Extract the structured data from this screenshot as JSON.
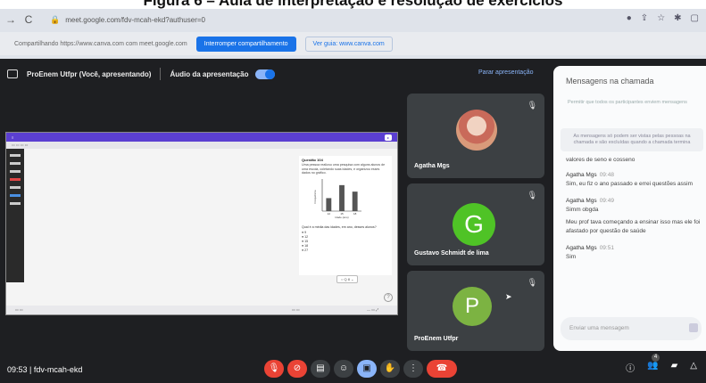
{
  "figure": {
    "caption": "Figura 6 – Aula de interpretação e resolução de exercícios"
  },
  "browser": {
    "back_glyph": "→",
    "reload_glyph": "C",
    "url": "meet.google.com/fdv-mcah-ekd?authuser=0",
    "share_text": "Compartilhando https://www.canva.com com meet.google.com",
    "stop_share_label": "Interromper compartilhamento",
    "guide_label": "Ver guia: www.canva.com"
  },
  "presentation_bar": {
    "title": "ProEnem Utfpr (Você, apresentando)",
    "audio_label": "Áudio da apresentação",
    "stop_label": "Parar apresentação"
  },
  "shared_screen": {
    "question_title": "Questão 104",
    "question_text": "Uma pessoa realizou uma pesquisa com alguns alunos de uma escola, coletando suas idades, e organizou esses dados no gráfico.",
    "question_prompt": "Qual é a média das idades, em ano, desses alunos?",
    "options": [
      "9",
      "12",
      "15",
      "18",
      "27"
    ],
    "zoom_label": "○ Q 8 ⌄"
  },
  "chart_data": {
    "type": "bar",
    "categories": [
      "12",
      "15",
      "18"
    ],
    "values": [
      6,
      12,
      9
    ],
    "xlabel": "Idade (ano)",
    "ylabel": "Frequência"
  },
  "participants": [
    {
      "name": "Agatha Mgs"
    },
    {
      "name": "Gustavo Schmidt de lima",
      "initial": "G"
    },
    {
      "name": "ProEnem Utfpr",
      "initial": "P"
    }
  ],
  "chat": {
    "title": "Mensagens na chamada",
    "toggle_note": "Permitir que todos os participantes enviem mensagens",
    "info_note": "As mensagens só podem ser vistas pelas pessoas na chamada e são excluídas quando a chamada termina",
    "continued_text": "valores de seno e cosseno",
    "messages": [
      {
        "author": "Agatha Mgs",
        "time": "09:48",
        "text": "Sim, eu fiz o ano passado e errei questões assim"
      },
      {
        "author": "Agatha Mgs",
        "time": "09:49",
        "text": "Simm obgda"
      },
      {
        "author": "",
        "time": "",
        "text": "Meu prof tava começando a ensinar isso mas ele foi afastado por questão de saúde"
      },
      {
        "author": "Agatha Mgs",
        "time": "09:51",
        "text": "Sim"
      }
    ],
    "input_placeholder": "Enviar uma mensagem"
  },
  "bottom_bar": {
    "meeting_info": "09:53 | fdv-mcah-ekd",
    "participant_count": "4"
  }
}
